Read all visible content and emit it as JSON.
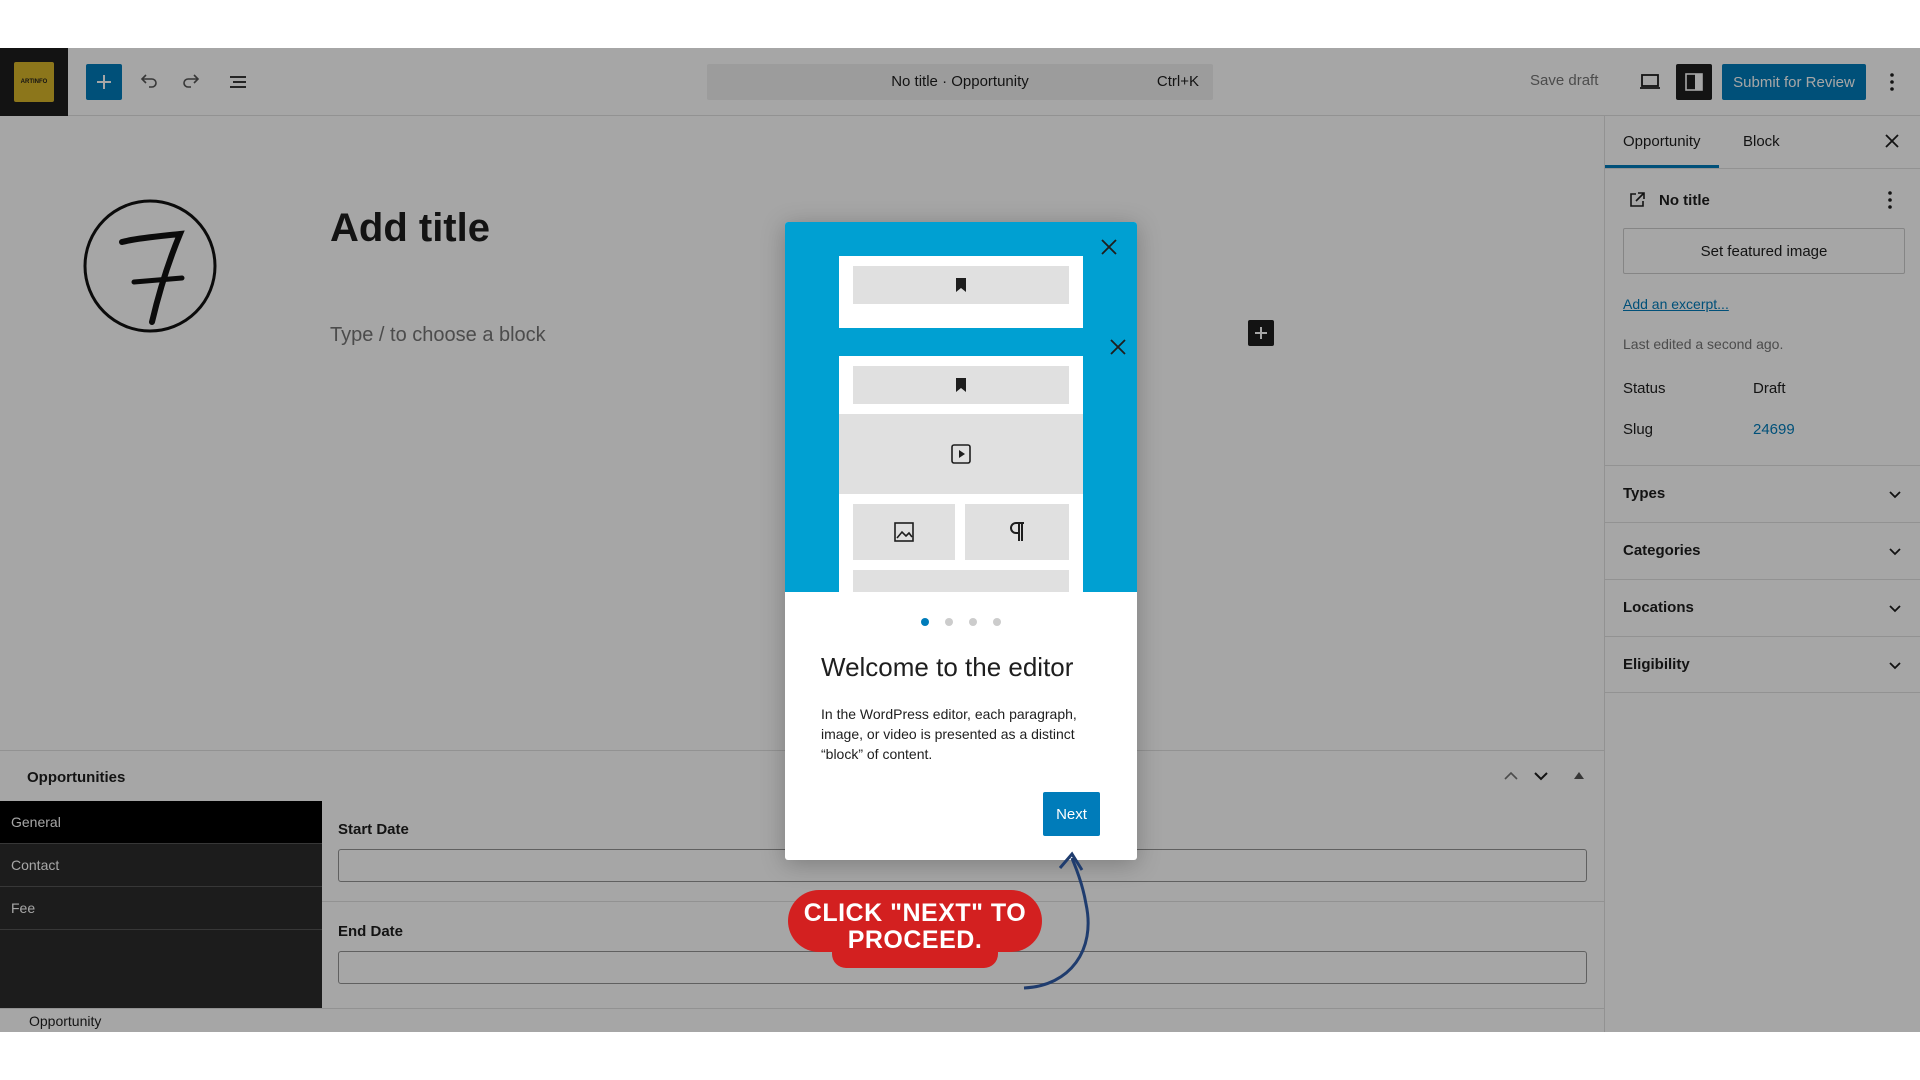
{
  "toolbar": {
    "logo_text": "ARTINFO",
    "document_title": "No title · Opportunity",
    "shortcut": "Ctrl+K",
    "save_draft": "Save draft",
    "submit": "Submit for Review"
  },
  "editor": {
    "title_placeholder": "Add title",
    "block_placeholder": "Type / to choose a block"
  },
  "metabox": {
    "title": "Opportunities",
    "tabs": [
      "General",
      "Contact",
      "Fee"
    ],
    "fields": [
      {
        "label": "Start Date",
        "value": ""
      },
      {
        "label": "End Date",
        "value": ""
      }
    ]
  },
  "footer": {
    "breadcrumb": "Opportunity"
  },
  "sidebar": {
    "tabs": [
      "Opportunity",
      "Block"
    ],
    "post_name": "No title",
    "featured_button": "Set featured image",
    "excerpt_link": "Add an excerpt...",
    "last_edited": "Last edited a second ago.",
    "status_label": "Status",
    "status_value": "Draft",
    "slug_label": "Slug",
    "slug_value": "24699",
    "sections": [
      "Types",
      "Categories",
      "Locations",
      "Eligibility"
    ]
  },
  "guide": {
    "heading": "Welcome to the editor",
    "text": "In the WordPress editor, each paragraph, image, or video is presented as a distinct “block” of content.",
    "next": "Next",
    "pages": 4,
    "current_page": 1
  },
  "callout": {
    "text": "CLICK \"NEXT\" TO PROCEED."
  },
  "colors": {
    "accent": "#007cba",
    "guide_bg": "#00a0d2",
    "callout": "#d32020"
  }
}
